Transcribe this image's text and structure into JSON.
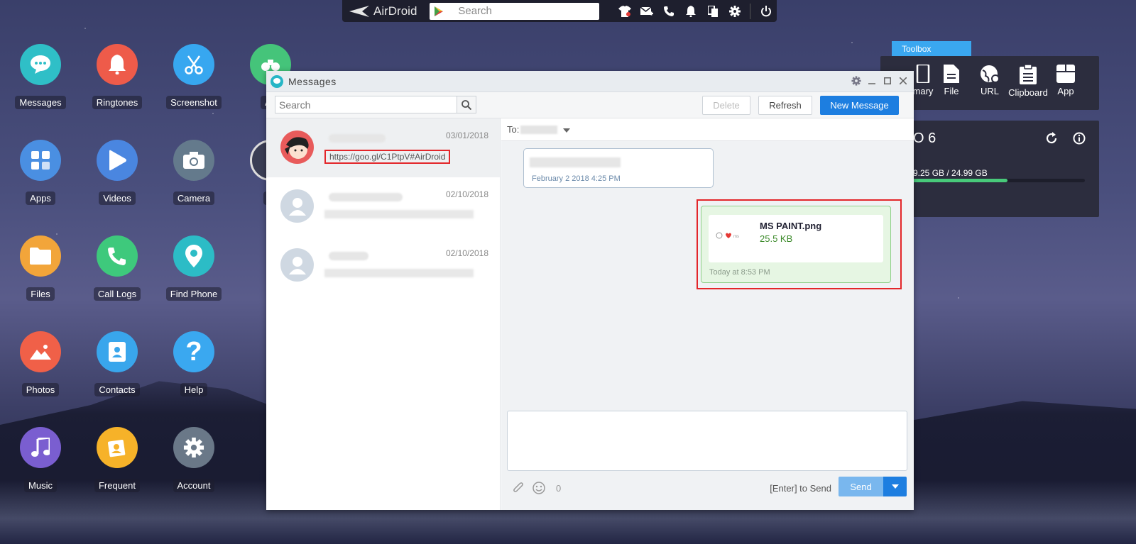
{
  "topbar": {
    "brand": "AirDroid",
    "search_placeholder": "Search",
    "icons": [
      "tshirt-icon",
      "mail-icon",
      "phone-icon",
      "bell-icon",
      "copy-icon",
      "gear-icon",
      "power-icon"
    ]
  },
  "desktop": {
    "apps": [
      {
        "label": "Messages",
        "color": "#2fbfc7"
      },
      {
        "label": "Ringtones",
        "color": "#ee5b4a"
      },
      {
        "label": "Screenshot",
        "color": "#37a7f0"
      },
      {
        "label": "Air",
        "color": "#45c47a"
      },
      {
        "label": "Apps",
        "color": "#4a8fe2"
      },
      {
        "label": "Videos",
        "color": "#4a86e0"
      },
      {
        "label": "Camera",
        "color": "#647a8c"
      },
      {
        "label": "Files",
        "color": "#f2a53a"
      },
      {
        "label": "Call Logs",
        "color": "#3ec97c"
      },
      {
        "label": "Find Phone",
        "color": "#2cbcc6"
      },
      {
        "label": "Photos",
        "color": "#f06048"
      },
      {
        "label": "Contacts",
        "color": "#39a6ec"
      },
      {
        "label": "Help",
        "color": "#3aa8f0"
      },
      {
        "label": "Music",
        "color": "#7a5ed0"
      },
      {
        "label": "Frequent",
        "color": "#f6b229"
      },
      {
        "label": "Account",
        "color": "#6a7888"
      },
      {
        "label": "A",
        "color": "#3a3e55"
      }
    ]
  },
  "toolbox": {
    "tab_label": "Toolbox",
    "items": [
      {
        "label": "mary",
        "icon": "phone-summary-icon"
      },
      {
        "label": "File",
        "icon": "file-icon"
      },
      {
        "label": "URL",
        "icon": "globe-icon"
      },
      {
        "label": "Clipboard",
        "icon": "clipboard-icon"
      },
      {
        "label": "App",
        "icon": "app-icon"
      }
    ]
  },
  "device": {
    "name": "O 6",
    "storage": "9.25 GB / 24.99 GB",
    "storage_fraction": 0.56
  },
  "messages": {
    "title": "Messages",
    "search_placeholder": "Search",
    "buttons": {
      "delete": "Delete",
      "refresh": "Refresh",
      "new_message": "New Message"
    },
    "conversations": [
      {
        "date": "03/01/2018",
        "preview": "https://goo.gl/C1PtpV#AirDroid"
      },
      {
        "date": "02/10/2018"
      },
      {
        "date": "02/10/2018"
      }
    ],
    "to_label": "To:",
    "incoming": {
      "time": "February 2 2018 4:25 PM"
    },
    "outgoing": {
      "file_name": "MS PAINT.png",
      "file_size": "25.5 KB",
      "time": "Today at 8:53 PM"
    },
    "compose": {
      "char_count": "0",
      "send_hint": "[Enter] to Send",
      "send_label": "Send"
    }
  }
}
